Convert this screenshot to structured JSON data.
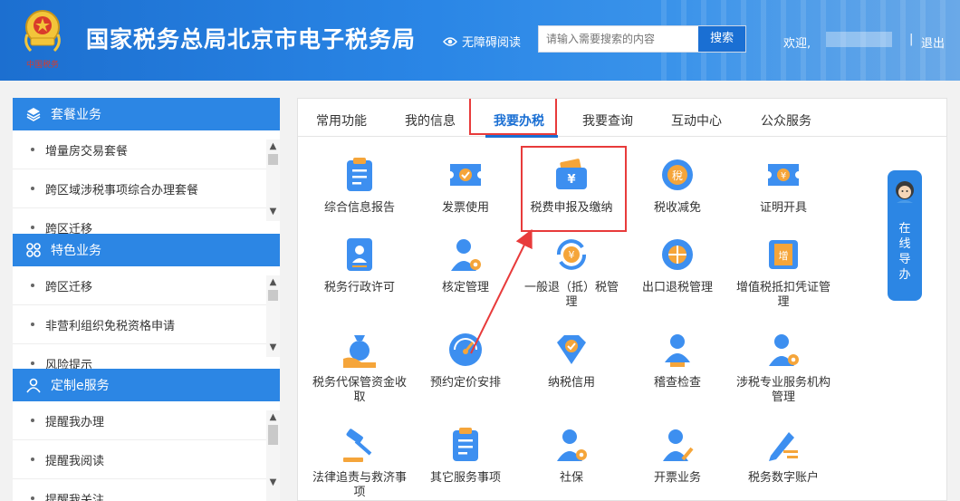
{
  "header": {
    "site_title": "国家税务总局北京市电子税务局",
    "a11y_label": "无障碍阅读",
    "search_placeholder": "请输入需要搜索的内容",
    "search_button": "搜索",
    "welcome": "欢迎,",
    "separator": "|",
    "logout": "退出",
    "emblem_text": "中国税务"
  },
  "sidebar": {
    "sections": [
      {
        "title": "套餐业务",
        "icon": "layers-icon",
        "items": [
          "增量房交易套餐",
          "跨区域涉税事项综合办理套餐",
          "跨区迁移"
        ]
      },
      {
        "title": "特色业务",
        "icon": "grid-icon",
        "items": [
          "跨区迁移",
          "非营利组织免税资格申请",
          "风险提示"
        ]
      },
      {
        "title": "定制e服务",
        "icon": "user-icon",
        "items": [
          "提醒我办理",
          "提醒我阅读",
          "提醒我关注"
        ]
      }
    ]
  },
  "tabs": [
    "常用功能",
    "我的信息",
    "我要办税",
    "我要查询",
    "互动中心",
    "公众服务"
  ],
  "active_tab": "我要办税",
  "services": [
    {
      "label": "综合信息报告",
      "icon": "clipboard-icon"
    },
    {
      "label": "发票使用",
      "icon": "ticket-check-icon"
    },
    {
      "label": "税费申报及缴纳",
      "icon": "wallet-yuan-icon"
    },
    {
      "label": "税收减免",
      "icon": "coin-reduce-icon"
    },
    {
      "label": "证明开具",
      "icon": "ticket-yuan-icon"
    },
    {
      "label": "税务行政许可",
      "icon": "id-card-icon"
    },
    {
      "label": "核定管理",
      "icon": "user-gear-icon"
    },
    {
      "label": "一般退（抵）税管理",
      "icon": "yuan-refresh-icon"
    },
    {
      "label": "出口退税管理",
      "icon": "globe-icon"
    },
    {
      "label": "增值税抵扣凭证管理",
      "icon": "voucher-icon"
    },
    {
      "label": "税务代保管资金收取",
      "icon": "money-bag-icon"
    },
    {
      "label": "预约定价安排",
      "icon": "gauge-icon"
    },
    {
      "label": "纳税信用",
      "icon": "diamond-check-icon"
    },
    {
      "label": "稽查检查",
      "icon": "user-stamp-icon"
    },
    {
      "label": "涉税专业服务机构管理",
      "icon": "user-gear-icon"
    },
    {
      "label": "法律追责与救济事项",
      "icon": "gavel-icon"
    },
    {
      "label": "其它服务事项",
      "icon": "clipboard-icon"
    },
    {
      "label": "社保",
      "icon": "user-gear-icon"
    },
    {
      "label": "开票业务",
      "icon": "user-pen-icon"
    },
    {
      "label": "税务数字账户",
      "icon": "pen-lines-icon"
    }
  ],
  "guide_label": "在线导办",
  "colors": {
    "brand": "#2c86e4",
    "highlight": "#e83b3b",
    "icon_blue": "#3d8ff0",
    "icon_orange": "#f5a53a"
  }
}
